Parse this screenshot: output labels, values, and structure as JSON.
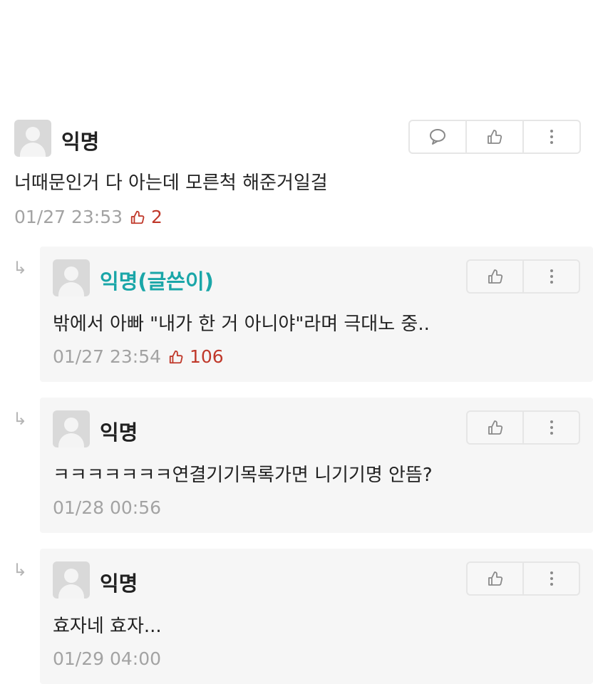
{
  "comments": [
    {
      "author": "익명",
      "content": "너때문인거 다 아는데 모른척 해준거일걸",
      "timestamp": "01/27 23:53",
      "likes": "2"
    }
  ],
  "replies": [
    {
      "author": "익명(글쓴이)",
      "content": "밖에서 아빠 \"내가 한 거 아니야\"라며 극대노 중..",
      "timestamp": "01/27 23:54",
      "likes": "106"
    },
    {
      "author": "익명",
      "content": "ㅋㅋㅋㅋㅋㅋㅋ연결기기목록가면 니기기명 안뜸?",
      "timestamp": "01/28 00:56",
      "likes": ""
    },
    {
      "author": "익명",
      "content": "효자네 효자...",
      "timestamp": "01/29 04:00",
      "likes": ""
    }
  ],
  "icons": {
    "reply_arrow": "↳",
    "comment": "speech-bubble-icon",
    "like": "thumbs-up-icon",
    "more": "kebab-menu-icon"
  },
  "colors": {
    "op_author": "#1aa6a8",
    "likes": "#c0392b",
    "meta": "#a3a3a3",
    "reply_bg": "#f6f6f6"
  }
}
